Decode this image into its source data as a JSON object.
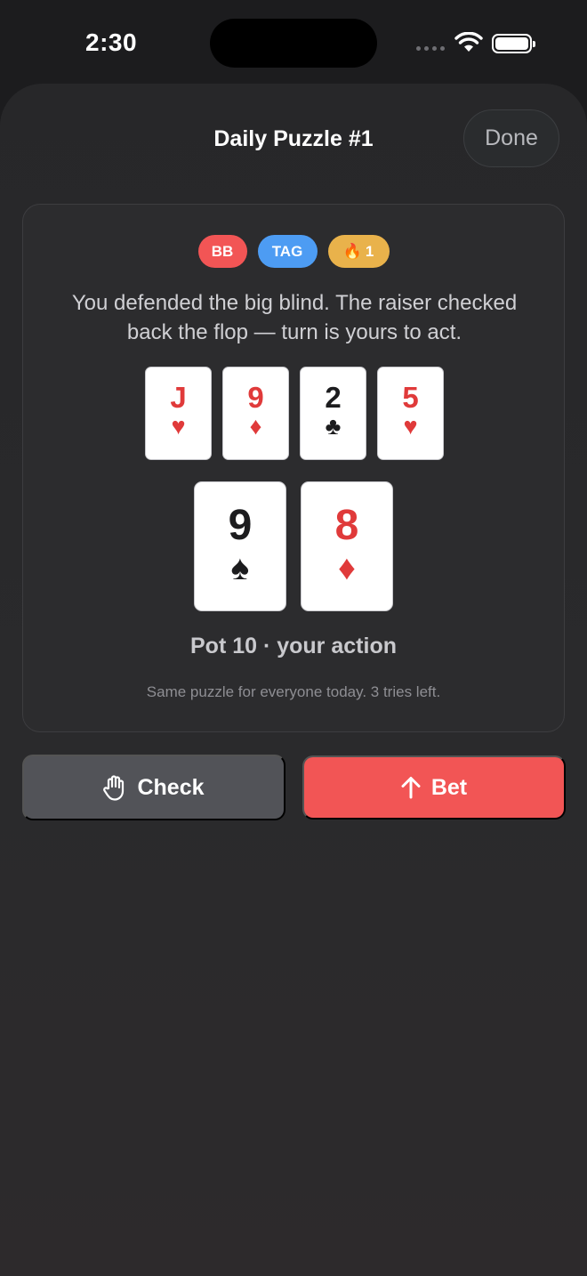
{
  "status_bar": {
    "time": "2:30"
  },
  "sheet": {
    "title": "Daily Puzzle #1",
    "done_label": "Done"
  },
  "badges": {
    "position": "BB",
    "opponent_type": "TAG",
    "streak_icon": "🔥",
    "streak_count": "1"
  },
  "scenario": "You defended the big blind. The raiser checked back the flop — turn is yours to act.",
  "board": [
    {
      "rank": "J",
      "suit": "♥",
      "color": "red"
    },
    {
      "rank": "9",
      "suit": "♦",
      "color": "red"
    },
    {
      "rank": "2",
      "suit": "♣",
      "color": "black"
    },
    {
      "rank": "5",
      "suit": "♥",
      "color": "red"
    }
  ],
  "hole_cards": [
    {
      "rank": "9",
      "suit": "♠",
      "color": "black"
    },
    {
      "rank": "8",
      "suit": "♦",
      "color": "red"
    }
  ],
  "pot_line": "Pot 10 · your action",
  "footnote": "Same puzzle for everyone today. 3 tries left.",
  "actions": {
    "check_label": "Check",
    "check_icon": "hand-raised-icon",
    "bet_label": "Bet",
    "bet_icon": "arrow-up-icon"
  },
  "colors": {
    "accent_red": "#f25555",
    "accent_blue": "#4d9cf3",
    "accent_gold": "#e9b24b",
    "card_red": "#e03a3a"
  }
}
